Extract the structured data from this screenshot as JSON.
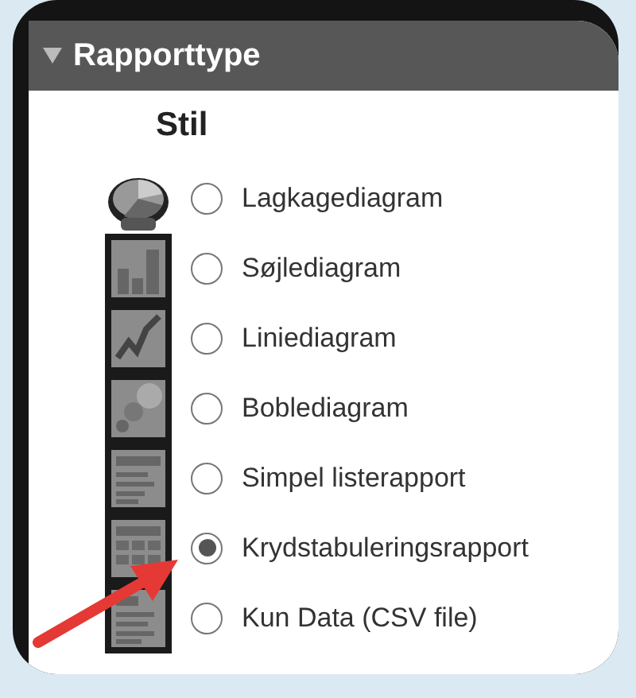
{
  "panel": {
    "title": "Rapporttype",
    "expanded": true
  },
  "section": {
    "title": "Stil"
  },
  "options": [
    {
      "kind": "pie",
      "label": "Lagkagediagram",
      "selected": false
    },
    {
      "kind": "bar",
      "label": "Søjlediagram",
      "selected": false
    },
    {
      "kind": "line",
      "label": "Liniediagram",
      "selected": false
    },
    {
      "kind": "bubble",
      "label": "Boblediagram",
      "selected": false
    },
    {
      "kind": "list",
      "label": "Simpel listerapport",
      "selected": false
    },
    {
      "kind": "crosstab",
      "label": "Krydstabuleringsrapport",
      "selected": true
    },
    {
      "kind": "data",
      "label": "Kun Data (CSV file)",
      "selected": false
    }
  ]
}
